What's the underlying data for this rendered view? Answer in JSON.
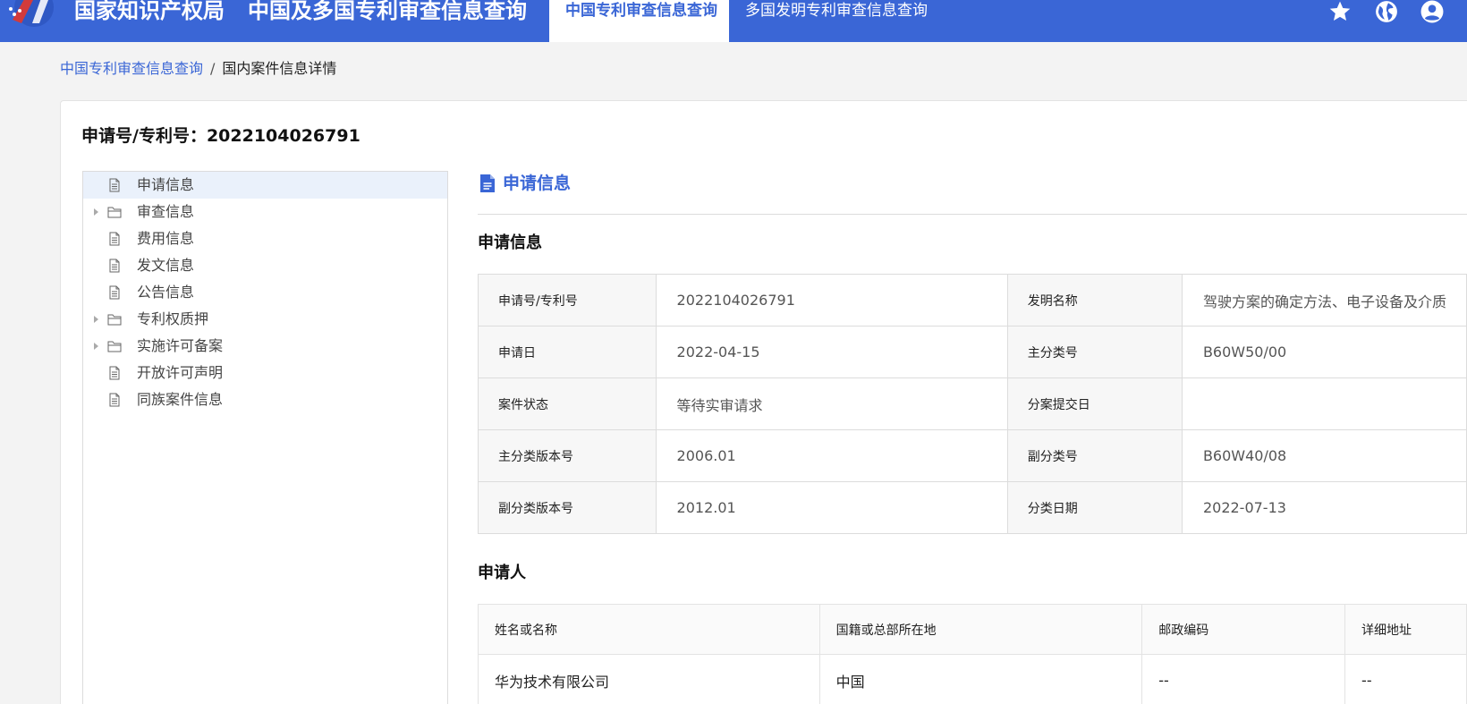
{
  "header": {
    "org_name": "国家知识产权局",
    "system_name": "中国及多国专利审查信息查询",
    "tabs": [
      {
        "label": "中国专利审查信息查询",
        "active": true
      },
      {
        "label": "多国发明专利审查信息查询",
        "active": false
      }
    ],
    "icons": [
      "star-icon",
      "globe-icon",
      "user-account-icon"
    ],
    "brand_color": "#3a66d6"
  },
  "breadcrumb": {
    "link": "中国专利审查信息查询",
    "separator": "/",
    "current": "国内案件信息详情"
  },
  "page": {
    "application_number_label": "申请号/专利号：2022104026791"
  },
  "tree": {
    "items": [
      {
        "label": "申请信息",
        "icon": "file-icon",
        "expandable": false,
        "selected": true
      },
      {
        "label": "审查信息",
        "icon": "folder-icon",
        "expandable": true,
        "selected": false
      },
      {
        "label": "费用信息",
        "icon": "file-icon",
        "expandable": false,
        "selected": false
      },
      {
        "label": "发文信息",
        "icon": "file-icon",
        "expandable": false,
        "selected": false
      },
      {
        "label": "公告信息",
        "icon": "file-icon",
        "expandable": false,
        "selected": false
      },
      {
        "label": "专利权质押",
        "icon": "folder-icon",
        "expandable": true,
        "selected": false
      },
      {
        "label": "实施许可备案",
        "icon": "folder-icon",
        "expandable": true,
        "selected": false
      },
      {
        "label": "开放许可声明",
        "icon": "file-icon",
        "expandable": false,
        "selected": false
      },
      {
        "label": "同族案件信息",
        "icon": "file-icon",
        "expandable": false,
        "selected": false
      }
    ]
  },
  "main": {
    "section_title": "申请信息",
    "info_title": "申请信息",
    "info_rows": [
      {
        "k1": "申请号/专利号",
        "v1": "2022104026791",
        "k2": "发明名称",
        "v2": "驾驶方案的确定方法、电子设备及介质"
      },
      {
        "k1": "申请日",
        "v1": "2022-04-15",
        "k2": "主分类号",
        "v2": "B60W50/00"
      },
      {
        "k1": "案件状态",
        "v1": "等待实审请求",
        "k2": "分案提交日",
        "v2": ""
      },
      {
        "k1": "主分类版本号",
        "v1": "2006.01",
        "k2": "副分类号",
        "v2": "B60W40/08"
      },
      {
        "k1": "副分类版本号",
        "v1": "2012.01",
        "k2": "分类日期",
        "v2": "2022-07-13"
      }
    ],
    "applicant_title": "申请人",
    "applicant_headers": [
      "姓名或名称",
      "国籍或总部所在地",
      "邮政编码",
      "详细地址"
    ],
    "applicant_rows": [
      [
        "华为技术有限公司",
        "中国",
        "--",
        "--"
      ]
    ]
  }
}
